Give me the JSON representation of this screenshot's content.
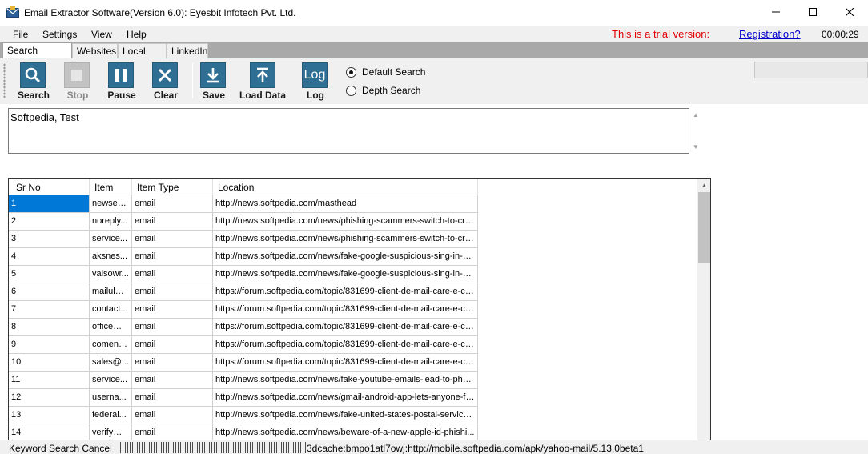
{
  "window": {
    "title": "Email Extractor Software(Version 6.0): Eyesbit Infotech Pvt. Ltd.",
    "minimize": "—",
    "maximize": "☐",
    "close": "✕"
  },
  "menu": {
    "items": [
      "File",
      "Settings",
      "View",
      "Help"
    ],
    "trial_notice": "This is a trial version:",
    "registration_link": "Registration?",
    "timer": "00:00:29"
  },
  "tabs": [
    {
      "label": "Search Engines",
      "active": true
    },
    {
      "label": "Websites",
      "active": false
    },
    {
      "label": "Local Files",
      "active": false
    },
    {
      "label": "LinkedIn",
      "active": false
    }
  ],
  "toolbar": {
    "buttons": [
      {
        "label": "Search",
        "icon": "search-icon",
        "enabled": true
      },
      {
        "label": "Stop",
        "icon": "stop-icon",
        "enabled": false
      },
      {
        "label": "Pause",
        "icon": "pause-icon",
        "enabled": true
      },
      {
        "label": "Clear",
        "icon": "clear-icon",
        "enabled": true
      },
      {
        "label": "Save",
        "icon": "download-icon",
        "enabled": true
      },
      {
        "label": "Load Data",
        "icon": "upload-icon",
        "enabled": true
      },
      {
        "label": "Log",
        "icon": "log-icon",
        "icon_text": "Log",
        "enabled": true
      }
    ],
    "search_modes": [
      {
        "label": "Default Search",
        "checked": true
      },
      {
        "label": "Depth Search",
        "checked": false
      }
    ]
  },
  "keywords": {
    "value": "Softpedia, Test"
  },
  "grid": {
    "columns": [
      "Sr No",
      "Item",
      "Item Type",
      "Location"
    ],
    "rows": [
      [
        "1",
        "newsed...",
        "email",
        "http://news.softpedia.com/masthead"
      ],
      [
        "2",
        "noreply...",
        "email",
        "http://news.softpedia.com/news/phishing-scammers-switch-to-cry..."
      ],
      [
        "3",
        "service...",
        "email",
        "http://news.softpedia.com/news/phishing-scammers-switch-to-cry..."
      ],
      [
        "4",
        "aksnes...",
        "email",
        "http://news.softpedia.com/news/fake-google-suspicious-sing-in-pr..."
      ],
      [
        "5",
        "valsowr...",
        "email",
        "http://news.softpedia.com/news/fake-google-suspicious-sing-in-pr..."
      ],
      [
        "6",
        "mailulm...",
        "email",
        "https://forum.softpedia.com/topic/831699-client-de-mail-care-e-cel..."
      ],
      [
        "7",
        "contact...",
        "email",
        "https://forum.softpedia.com/topic/831699-client-de-mail-care-e-cel..."
      ],
      [
        "8",
        "office@...",
        "email",
        "https://forum.softpedia.com/topic/831699-client-de-mail-care-e-cel..."
      ],
      [
        "9",
        "comenz...",
        "email",
        "https://forum.softpedia.com/topic/831699-client-de-mail-care-e-cel..."
      ],
      [
        "10",
        "sales@...",
        "email",
        "https://forum.softpedia.com/topic/831699-client-de-mail-care-e-cel..."
      ],
      [
        "11",
        "service...",
        "email",
        "http://news.softpedia.com/news/fake-youtube-emails-lead-to-phar..."
      ],
      [
        "12",
        "userna...",
        "email",
        "http://news.softpedia.com/news/gmail-android-app-lets-anyone-fa..."
      ],
      [
        "13",
        "federal...",
        "email",
        "http://news.softpedia.com/news/fake-united-states-postal-service..."
      ],
      [
        "14",
        "verify@...",
        "email",
        "http://news.softpedia.com/news/beware-of-a-new-apple-id-phishi..."
      ]
    ],
    "selected_row": 0
  },
  "status": {
    "text": "Keyword Search Cancel",
    "detail": "3dcache:bmpo1atl7owj:http://mobile.softpedia.com/apk/yahoo-mail/5.13.0beta1"
  },
  "colors": {
    "toolbar_icon_bg": "#2f6f93",
    "selection": "#0078d7",
    "trial_text": "#e00000",
    "link": "#0000cc"
  }
}
